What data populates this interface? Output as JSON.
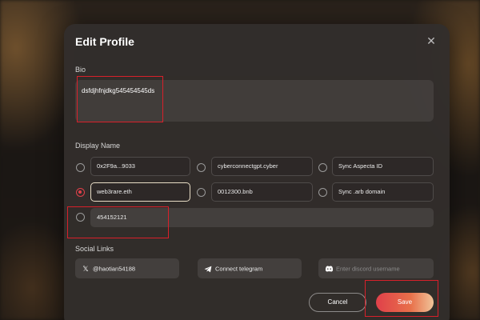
{
  "modal": {
    "title": "Edit Profile",
    "close_icon": "close-icon"
  },
  "bio": {
    "label": "Bio",
    "value": "dsfdjhfnjdkg545454545ds"
  },
  "display_name": {
    "label": "Display Name",
    "options": [
      {
        "label": "0x2F9a...9033",
        "selected": false
      },
      {
        "label": "cyberconnectgpt.cyber",
        "selected": false
      },
      {
        "label": "Sync Aspecta ID",
        "selected": false
      },
      {
        "label": "web3rare.eth",
        "selected": true
      },
      {
        "label": "0012300.bnb",
        "selected": false
      },
      {
        "label": "Sync .arb domain",
        "selected": false
      }
    ],
    "custom_value": "454152121"
  },
  "social": {
    "label": "Social Links",
    "twitter": {
      "icon": "x-icon",
      "value": "@haotian54188"
    },
    "telegram": {
      "icon": "telegram-icon",
      "value": "Connect telegram"
    },
    "discord": {
      "icon": "discord-icon",
      "placeholder": "Enter discord username"
    }
  },
  "actions": {
    "cancel_label": "Cancel",
    "save_label": "Save"
  },
  "colors": {
    "accent": "#e0404a",
    "annotation": "#d8202a"
  }
}
